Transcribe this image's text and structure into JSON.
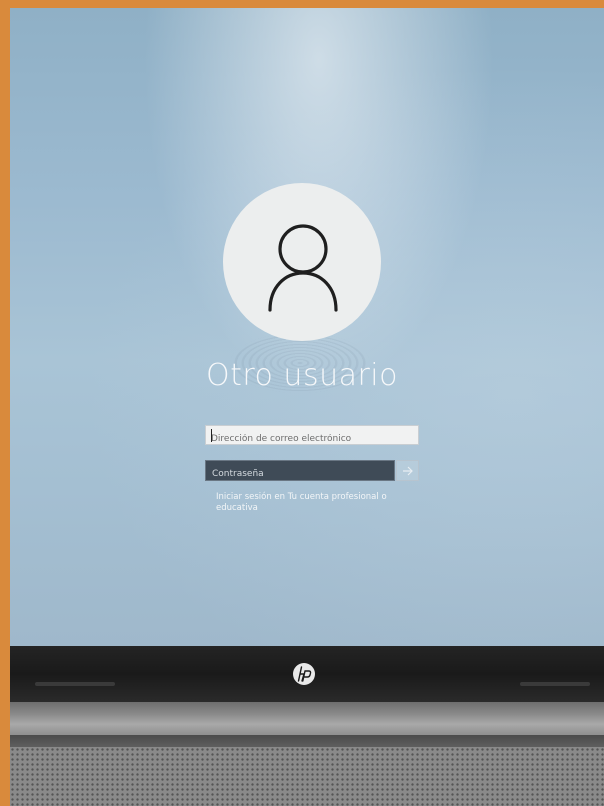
{
  "login": {
    "user_name": "Otro usuario",
    "email_placeholder": "Dirección de correo electrónico",
    "password_placeholder": "Contraseña",
    "signin_link": "Iniciar sesión en Tu cuenta profesional o educativa"
  },
  "icons": {
    "avatar": "user-avatar-icon",
    "submit": "arrow-right-icon",
    "logo": "hp-logo"
  },
  "colors": {
    "background_top": "#8fb0c6",
    "background_bottom": "#9fb8cb",
    "avatar_circle": "#eceeee",
    "password_field": "#3f4b57",
    "text": "#f6f8fa",
    "frame_border": "#d98a3c"
  },
  "device": {
    "brand": "hp"
  }
}
